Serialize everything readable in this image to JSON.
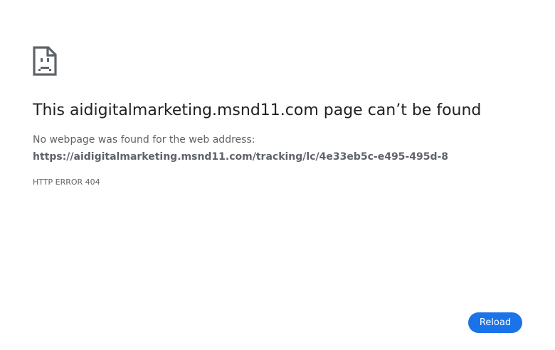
{
  "error_page": {
    "title": "This aidigitalmarketing.msnd11.com page can’t be found",
    "description": "No webpage was found for the web address:",
    "url": "https://aidigitalmarketing.msnd11.com/tracking/lc/4e33eb5c-e495-495d-8",
    "error_code": "HTTP ERROR 404"
  },
  "actions": {
    "reload_label": "Reload"
  },
  "icons": {
    "main_icon": "sad-page-icon"
  },
  "colors": {
    "accent": "#1a73e8",
    "icon": "#5f6368",
    "title_text": "#202124",
    "body_text": "#5f6368"
  }
}
